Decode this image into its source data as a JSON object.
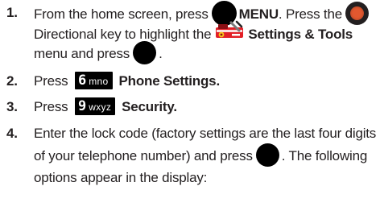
{
  "steps": [
    {
      "number": "1.",
      "lines": {
        "l1_a": "From the home screen, press",
        "l1_b": "MENU",
        "l1_c": ". Press the",
        "l2_a": "Directional key to highlight the",
        "l2_b": "Settings & Tools",
        "l3_a": "menu and press",
        "l3_b": "."
      }
    },
    {
      "number": "2.",
      "press": "Press",
      "key_digit": "6",
      "key_letters": "mno",
      "label": "Phone Settings",
      "end": "."
    },
    {
      "number": "3.",
      "press": "Press",
      "key_digit": "9",
      "key_letters": "wxyz",
      "label": "Security",
      "end": "."
    },
    {
      "number": "4.",
      "lines": {
        "l1": "Enter the lock code (factory settings are the last four digits",
        "l2_a": "of your telephone number) and press",
        "l2_b": ". The following",
        "l3": "options appear in the display:"
      }
    }
  ],
  "icons": {
    "ok_key": "ok-key-icon",
    "directional_key": "directional-key-icon",
    "settings_tools": "settings-tools-icon"
  },
  "colors": {
    "text": "#231f20",
    "key_black": "#000000",
    "nav_orange": "#e2582f",
    "tools_red": "#e21f26"
  }
}
